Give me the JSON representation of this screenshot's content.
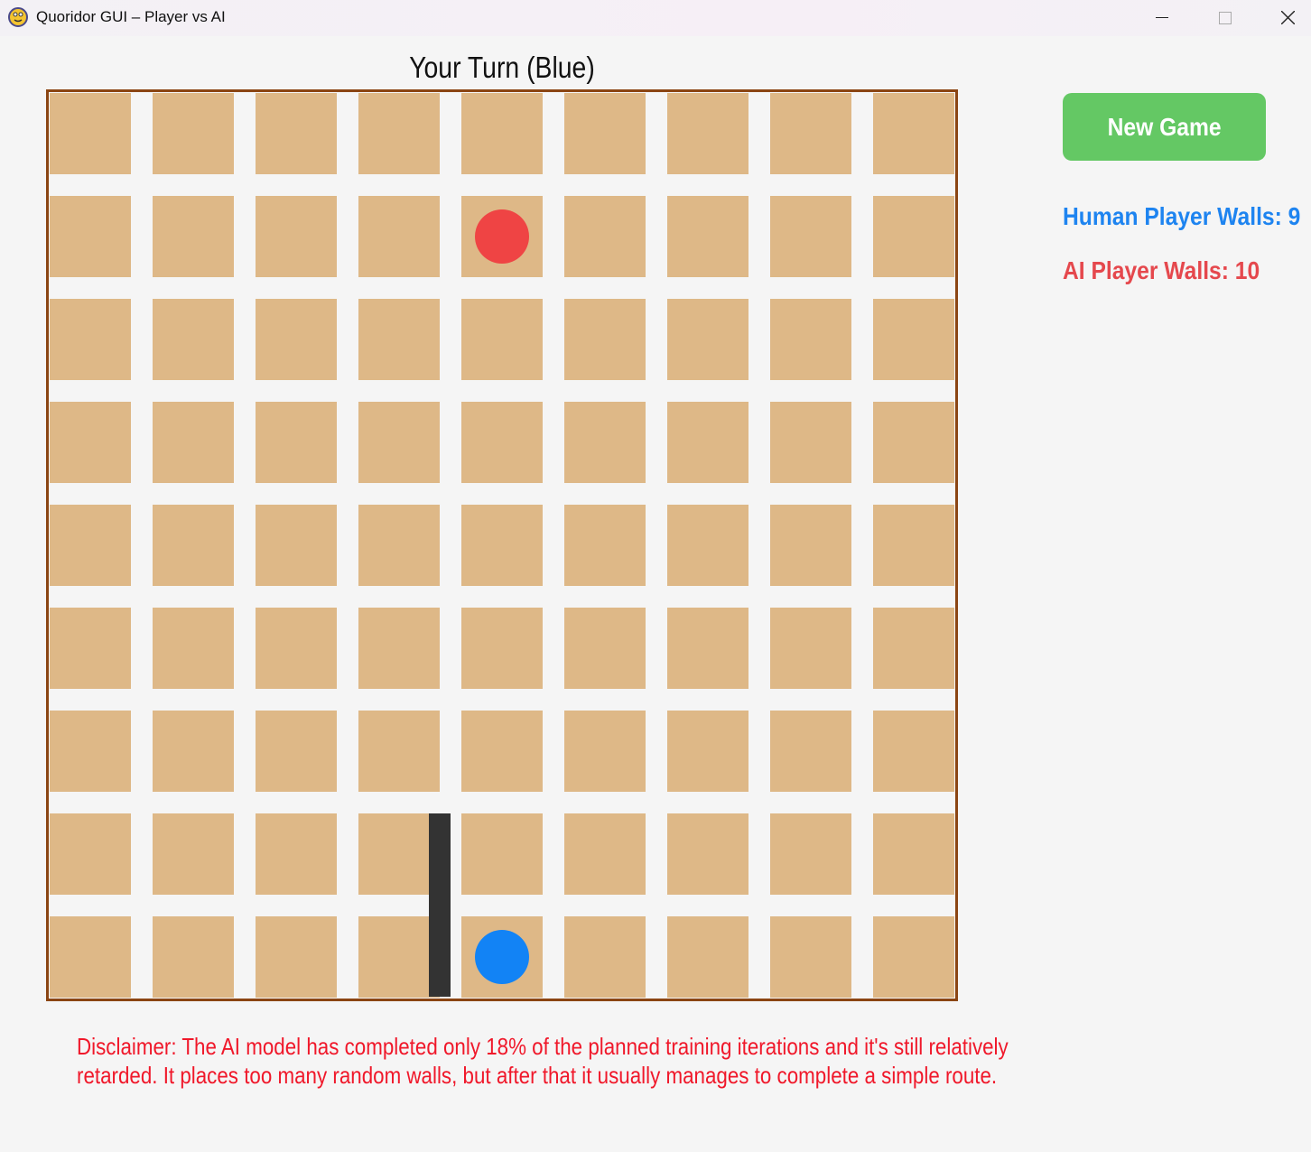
{
  "window": {
    "title": "Quoridor GUI – Player vs AI"
  },
  "status": "Your Turn (Blue)",
  "board": {
    "size": 9,
    "pawns": [
      {
        "player": "ai",
        "row": 1,
        "col": 4,
        "color": "#ef4444"
      },
      {
        "player": "human",
        "row": 8,
        "col": 4,
        "color": "#1283f5"
      }
    ],
    "walls": [
      {
        "orientation": "vertical",
        "row": 7,
        "col": 3
      }
    ],
    "colors": {
      "cell": "#deb887",
      "border": "#8b4513",
      "wall": "#333333"
    }
  },
  "sidebar": {
    "new_game_label": "New Game",
    "human_walls": "Human Player Walls: 9",
    "ai_walls": "AI Player Walls: 10",
    "colors": {
      "button": "#64c864",
      "human": "#1e84f0",
      "ai": "#e5484d"
    }
  },
  "disclaimer": {
    "line1": "Disclaimer: The AI model has completed only 18% of the planned training iterations and it's still relatively",
    "line2": "retarded. It places too many random walls, but after that it usually manages to complete a simple route.",
    "color": "#f0182a"
  }
}
